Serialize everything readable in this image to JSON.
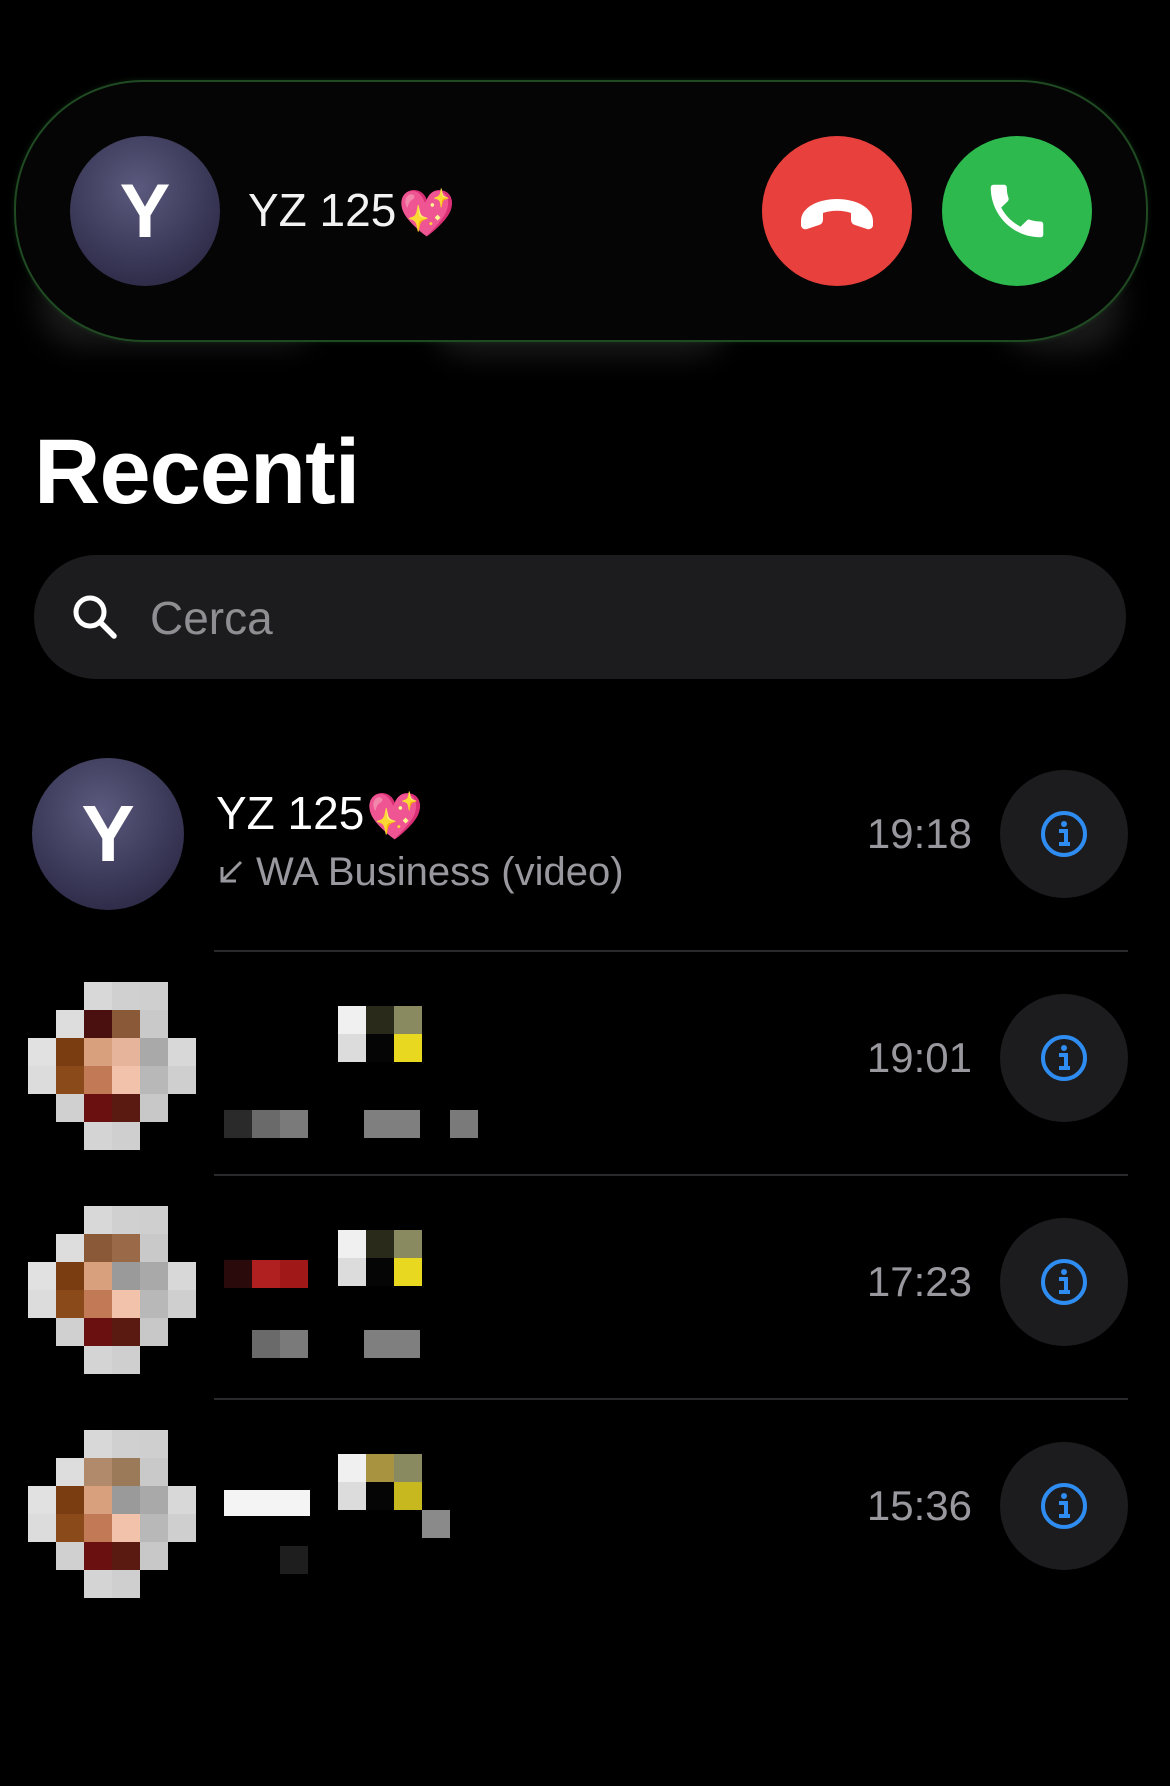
{
  "call_banner": {
    "avatar_initial": "Y",
    "caller_name": "YZ 125",
    "caller_emoji": "💖",
    "decline_color": "#e8403d",
    "accept_color": "#2db94d"
  },
  "page": {
    "title": "Recenti"
  },
  "search": {
    "placeholder": "Cerca"
  },
  "recents": [
    {
      "avatar_initial": "Y",
      "name": "YZ 125",
      "emoji": "💖",
      "type_icon": "incoming-arrow-icon",
      "subtitle": "WA Business (video)",
      "time": "19:18"
    },
    {
      "time": "19:01"
    },
    {
      "time": "17:23"
    },
    {
      "time": "15:36"
    }
  ],
  "accent_color": "#2f8cf0"
}
